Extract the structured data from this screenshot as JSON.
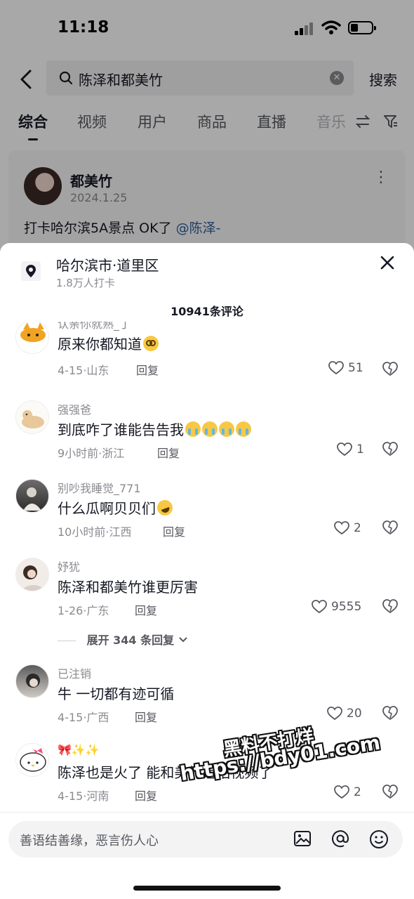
{
  "status_bar": {
    "time": "11:18"
  },
  "search": {
    "query": "陈泽和都美竹",
    "button_label": "搜索"
  },
  "tabs": [
    {
      "label": "综合",
      "active": true
    },
    {
      "label": "视频"
    },
    {
      "label": "用户"
    },
    {
      "label": "商品"
    },
    {
      "label": "直播"
    },
    {
      "label": "音乐"
    }
  ],
  "post": {
    "author": "都美竹",
    "date": "2024.1.25",
    "text": "打卡哈尔滨5A景点 OK了",
    "mention": "@陈泽-"
  },
  "sheet": {
    "location_name": "哈尔滨市·道里区",
    "location_sub": "1.8万人打卡",
    "comment_count": "10941条评论",
    "expand_label": "展开 344 条回复"
  },
  "comments": [
    {
      "user": "认亲你就熟_丁",
      "text": "原来你都知道",
      "emoji": "flush",
      "meta": "4-15·山东",
      "reply": "回复",
      "likes": "51"
    },
    {
      "user": "强强爸",
      "text": "到底咋了谁能告告我",
      "emoji": "cry",
      "emoji_count": 4,
      "meta": "9小时前·浙江",
      "reply": "回复",
      "likes": "1"
    },
    {
      "user": "别吵我睡觉_771",
      "text": "什么瓜啊贝贝们",
      "emoji": "rofl",
      "meta": "10小时前·江西",
      "reply": "回复",
      "likes": "2"
    },
    {
      "user": "妤犹",
      "text": "陈泽和都美竹谁更厉害",
      "meta": "1-26·广东",
      "reply": "回复",
      "likes": "9555"
    },
    {
      "user": "已注销",
      "text": "牛 一切都有迹可循",
      "meta": "4-15·广西",
      "reply": "回复",
      "likes": "20"
    },
    {
      "user": "🎀✨✨",
      "text": "陈泽也是火了 能和美竹姐拍视频了",
      "meta": "4-15·河南",
      "reply": "回复",
      "likes": "2"
    }
  ],
  "watermark": {
    "line1": "黑料不打烊",
    "line2": "https://bdy01.com"
  },
  "input": {
    "placeholder": "善语结善缘，恶言伤人心"
  },
  "icons": [
    "back-arrow-icon",
    "search-icon",
    "clear-icon",
    "sort-icon",
    "filter-icon",
    "more-icon",
    "location-pin-icon",
    "close-icon",
    "heart-icon",
    "dislike-heart-icon",
    "chevron-down-icon",
    "image-icon",
    "at-icon",
    "emoji-icon"
  ]
}
